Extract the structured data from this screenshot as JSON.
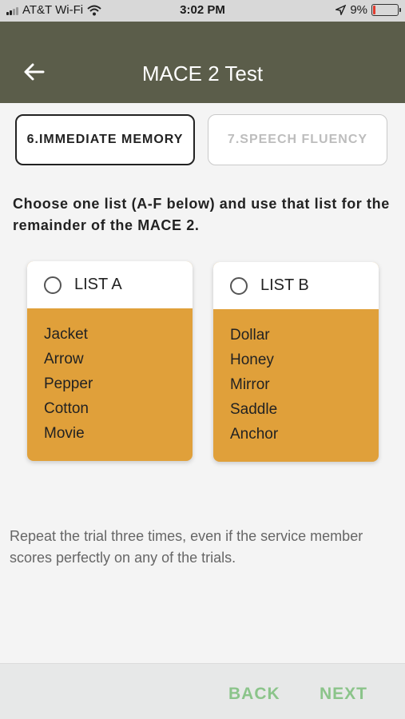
{
  "status_bar": {
    "carrier": "AT&T Wi-Fi",
    "time": "3:02 PM",
    "battery": "9%",
    "battery_level": 0.09,
    "icons": [
      "signal-icon",
      "wifi-icon",
      "location-icon",
      "battery-icon"
    ]
  },
  "app_bar": {
    "title": "MACE 2 Test",
    "back_icon": "arrow-left-icon"
  },
  "tabs": [
    {
      "label": "6.IMMEDIATE MEMORY",
      "active": true
    },
    {
      "label": "7.SPEECH FLUENCY",
      "active": false
    }
  ],
  "instructions": "Choose one list (A-F below) and use that list for the remainder of the MACE 2.",
  "lists": [
    {
      "label": "LIST A",
      "selected": false,
      "words": [
        "Jacket",
        "Arrow",
        "Pepper",
        "Cotton",
        "Movie"
      ]
    },
    {
      "label": "LIST B",
      "selected": false,
      "words": [
        "Dollar",
        "Honey",
        "Mirror",
        "Saddle",
        "Anchor"
      ]
    }
  ],
  "note": "Repeat the trial three times, even if the service member scores perfectly on any of the trials.",
  "footer": {
    "back_label": "BACK",
    "next_label": "NEXT"
  },
  "colors": {
    "app_bar": "#5b5d4a",
    "card_body": "#e0a03a",
    "footer_button": "#8bc48a",
    "battery_low": "#e23b2e"
  }
}
